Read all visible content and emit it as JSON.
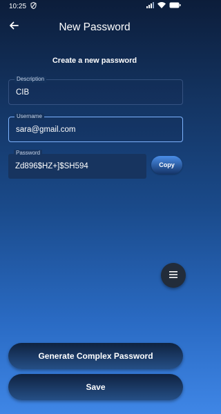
{
  "status": {
    "time": "10:25"
  },
  "header": {
    "title": "New Password"
  },
  "subtitle": "Create a new password",
  "fields": {
    "description": {
      "label": "Description",
      "value": "CIB"
    },
    "username": {
      "label": "Username",
      "value": "sara@gmail.com"
    },
    "password": {
      "label": "Password",
      "value": "Zd896$HZ+]$SH594"
    }
  },
  "buttons": {
    "copy": "Copy",
    "generate": "Generate Complex Password",
    "save": "Save"
  },
  "icons": {
    "back": "arrow-left-icon",
    "menu": "menu-icon",
    "shield": "shield-icon",
    "signal": "signal-icon",
    "wifi": "wifi-icon",
    "battery": "battery-icon"
  },
  "colors": {
    "background_top": "#0c1d3a",
    "background_bottom": "#3f86e6",
    "focus_border": "#7eb4ff",
    "fab": "#222c3a"
  }
}
